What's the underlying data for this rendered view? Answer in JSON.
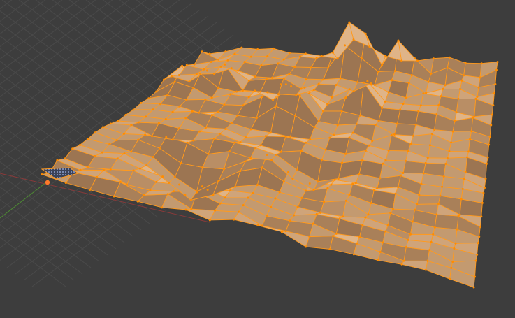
{
  "viewport": {
    "mode": "Edit Mode",
    "object": "terrain-mesh",
    "selection": "all-faces",
    "background_color": "#3d3d3d",
    "grid_color": "#4a4a4a",
    "x_axis_color": "#8a3a3a",
    "y_axis_color": "#4e8a34",
    "face_color": "#c99a6c",
    "face_shade_colors": [
      "#b98e65",
      "#c39a70",
      "#cfa47a",
      "#dfb488",
      "#a98059",
      "#9c7552"
    ],
    "edge_color": "#ff9a1e",
    "vertex_color": "#ff8c00",
    "origin_color": "#ff7a2a",
    "unselected_face_pattern_color": "#5a6a9a",
    "icons": [
      "origin-icon",
      "unselected-face-icon"
    ]
  }
}
